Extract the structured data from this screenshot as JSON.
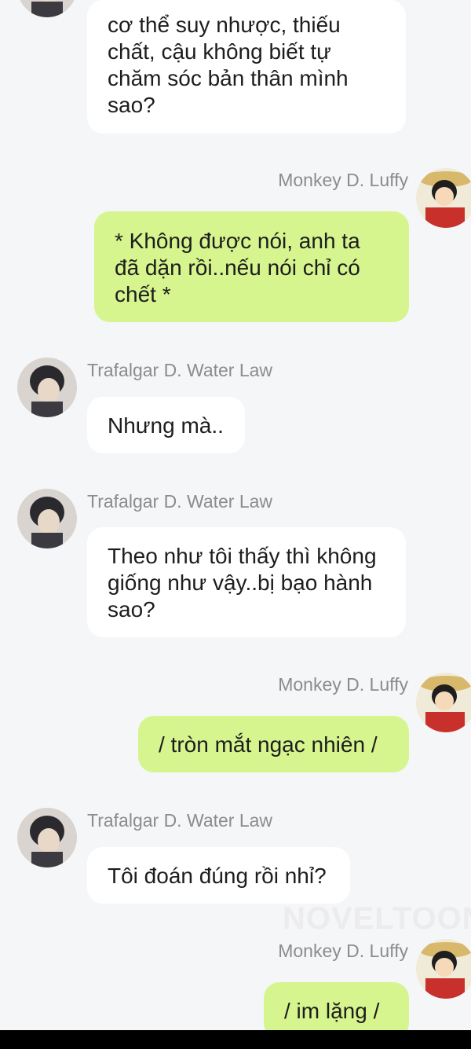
{
  "watermark": "NOVELTOON",
  "messages": [
    {
      "sender": "Trafalgar D. Water Law",
      "side": "in",
      "text": "cơ thể suy nhược, thiếu chất, cậu không biết tự chăm sóc bản thân mình sao?"
    },
    {
      "sender": "Monkey D. Luffy",
      "side": "out",
      "text": "* Không được nói, anh ta đã dặn rồi..nếu nói chỉ có chết *"
    },
    {
      "sender": "Trafalgar D. Water Law",
      "side": "in",
      "text": "Nhưng mà.."
    },
    {
      "sender": "Trafalgar D. Water Law",
      "side": "in",
      "text": "Theo như tôi thấy thì không giống như vậy..bị bạo hành sao?"
    },
    {
      "sender": "Monkey D. Luffy",
      "side": "out",
      "text": "/ tròn mắt ngạc nhiên /"
    },
    {
      "sender": "Trafalgar D. Water Law",
      "side": "in",
      "text": "Tôi đoán đúng rồi nhỉ?"
    },
    {
      "sender": "Monkey D. Luffy",
      "side": "out",
      "text": "/ im lặng /"
    }
  ]
}
